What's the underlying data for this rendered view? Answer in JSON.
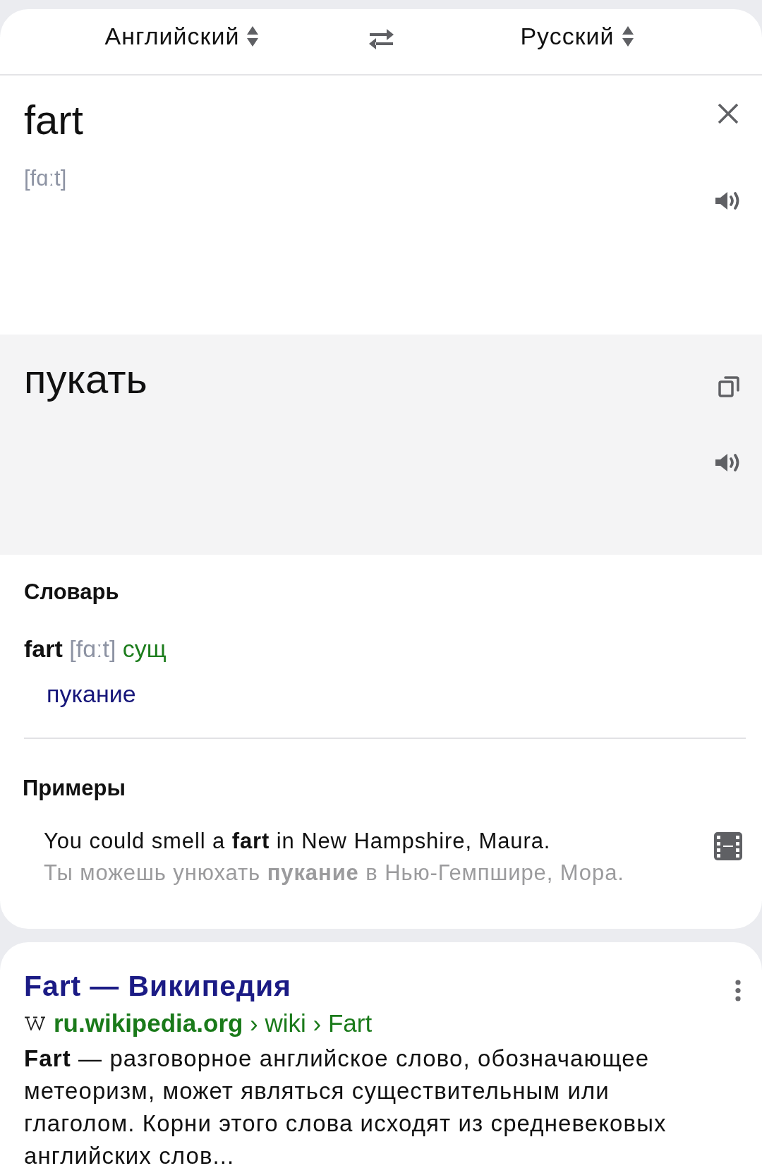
{
  "language_bar": {
    "source": "Английский",
    "target": "Русский"
  },
  "source_field": {
    "value": "fart",
    "transcription": "[fɑːt]"
  },
  "translation": {
    "text": "пукать"
  },
  "dictionary": {
    "title": "Словарь",
    "entries": [
      {
        "word": "fart",
        "transcription": "[fɑːt]",
        "part_of_speech": "сущ",
        "translations": [
          "пукание"
        ]
      }
    ]
  },
  "examples": {
    "title": "Примеры",
    "items": [
      {
        "source": "You could smell a **fart** in New Hampshire, Maura.",
        "translation": "Ты можешь унюхать **пукание** в Нью-Гемпшире, Мора."
      }
    ]
  },
  "results": [
    {
      "title": "Fart — Википедия",
      "url": "**ru.wikipedia.org** › wiki › Fart",
      "snippet": "**Fart** — разговорное английское слово, обозначающее метеоризм, может являться существительным или глаголом. Корни этого слова исходят из средневековых английских слов..."
    }
  ]
}
